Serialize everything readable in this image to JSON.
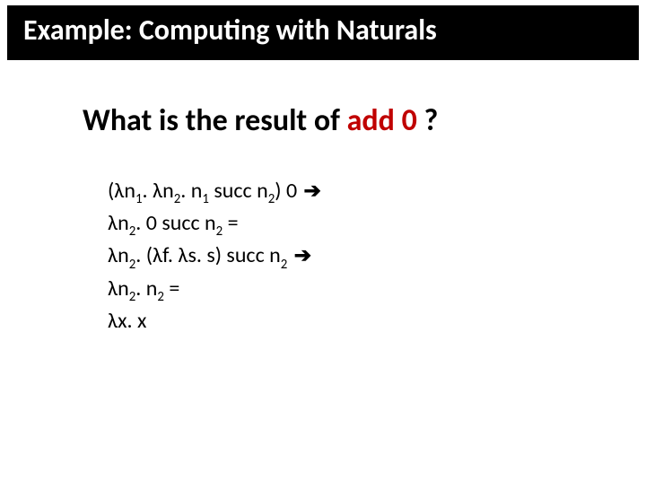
{
  "title": "Example: Computing with Naturals",
  "question": {
    "prefix": "What is the result of  ",
    "accent": "add 0",
    "suffix": " ?"
  },
  "lambda": "λ",
  "arrow": "➔",
  "derivation": {
    "line1": {
      "open": "(",
      "n1a": "n",
      "s1a": "1",
      "dot1": ". ",
      "n2a": "n",
      "s2a": "2",
      "dot2": ". n",
      "s1b": "1",
      "mid": " succ n",
      "s2b": "2",
      "close": ") 0  "
    },
    "line2": {
      "n2": "n",
      "s2": "2",
      "mid": ". 0 succ n",
      "s2b": "2",
      "tail": " ="
    },
    "line3": {
      "n2": "n",
      "s2": "2",
      "dotopen": ". (",
      "f": "f. ",
      "s": "s. s) succ n",
      "s2b": "2",
      "sp": " "
    },
    "line4": {
      "n2a": "n",
      "s2a": "2",
      "mid": ". n",
      "s2b": "2",
      "tail": " ="
    },
    "line5": {
      "body": "x. x"
    }
  }
}
